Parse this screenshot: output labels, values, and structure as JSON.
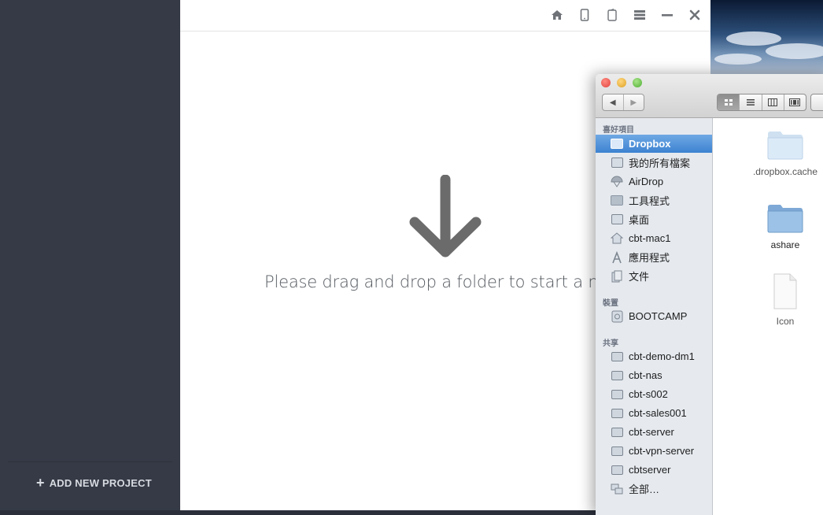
{
  "app": {
    "toolbar_icons": [
      "home-icon",
      "phone-icon",
      "tablet-icon",
      "menu-icon",
      "minimize-icon",
      "close-icon"
    ],
    "drop_message": "Please drag and drop a folder to start a new pro",
    "add_project_label": "ADD NEW PROJECT",
    "add_project_icon": "+"
  },
  "finder": {
    "sections": {
      "favorites": "喜好項目",
      "devices": "裝置",
      "shared": "共享"
    },
    "favorites": [
      {
        "label": "Dropbox",
        "icon": "folder-icon",
        "selected": true
      },
      {
        "label": "我的所有檔案",
        "icon": "all-files-icon"
      },
      {
        "label": "AirDrop",
        "icon": "airdrop-icon"
      },
      {
        "label": "工具程式",
        "icon": "folder-icon"
      },
      {
        "label": "桌面",
        "icon": "desktop-icon"
      },
      {
        "label": "cbt-mac1",
        "icon": "home-icon"
      },
      {
        "label": "應用程式",
        "icon": "applications-icon"
      },
      {
        "label": "文件",
        "icon": "documents-icon"
      }
    ],
    "devices": [
      {
        "label": "BOOTCAMP",
        "icon": "disk-icon"
      }
    ],
    "shared": [
      {
        "label": "cbt-demo-dm1",
        "icon": "computer-icon"
      },
      {
        "label": "cbt-nas",
        "icon": "computer-icon"
      },
      {
        "label": "cbt-s002",
        "icon": "computer-icon"
      },
      {
        "label": "cbt-sales001",
        "icon": "computer-icon"
      },
      {
        "label": "cbt-server",
        "icon": "computer-icon"
      },
      {
        "label": "cbt-vpn-server",
        "icon": "computer-icon"
      },
      {
        "label": "cbtserver",
        "icon": "computer-icon"
      },
      {
        "label": "全部…",
        "icon": "network-icon"
      }
    ],
    "files": [
      {
        "name": ".dropbox.cache",
        "type": "folder"
      },
      {
        "name": "ashare",
        "type": "folder"
      },
      {
        "name": "Icon",
        "type": "document"
      }
    ],
    "nav": {
      "back": "◀",
      "forward": "▶"
    }
  },
  "colors": {
    "sidebar_bg": "#353a46",
    "selection_blue": "#3d82d1",
    "arrow_gray": "#6b6b6b"
  }
}
